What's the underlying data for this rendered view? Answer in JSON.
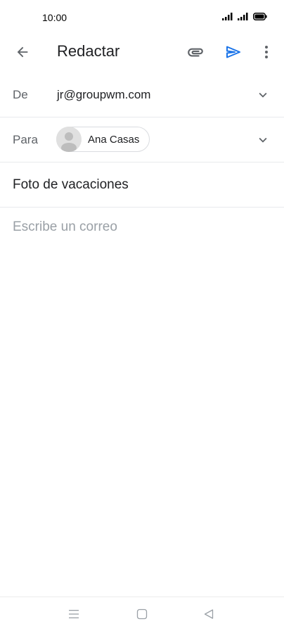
{
  "status_bar": {
    "time": "10:00",
    "icons": [
      "signal-icon",
      "signal-icon",
      "battery-icon"
    ]
  },
  "app_bar": {
    "title": "Redactar",
    "icons": {
      "back": "back-arrow-icon",
      "attach": "paperclip-icon",
      "send": "send-icon",
      "more": "more-vertical-icon"
    },
    "colors": {
      "send": "#1a73e8"
    }
  },
  "compose": {
    "from": {
      "label": "De",
      "value": "jr@groupwm.com"
    },
    "to": {
      "label": "Para",
      "recipient": "Ana Casas"
    },
    "subject": "Foto de vacaciones",
    "body_placeholder": "Escribe un correo"
  },
  "nav_bar": {
    "icons": [
      "menu-icon",
      "home-square-icon",
      "back-triangle-icon"
    ]
  }
}
